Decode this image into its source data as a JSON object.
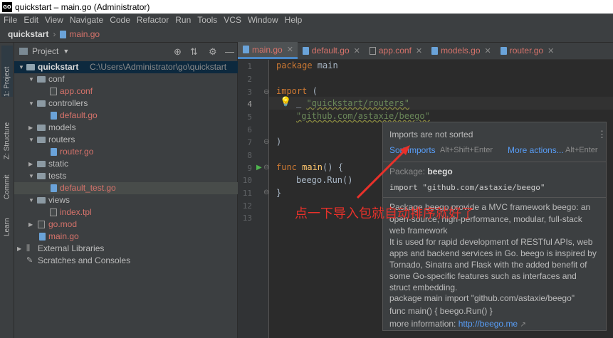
{
  "window": {
    "title": "quickstart – main.go (Administrator)",
    "logo_text": "GO"
  },
  "menu": [
    "File",
    "Edit",
    "View",
    "Navigate",
    "Code",
    "Refactor",
    "Run",
    "Tools",
    "VCS",
    "Window",
    "Help"
  ],
  "navbar": {
    "project": "quickstart",
    "file": "main.go"
  },
  "toolstrip": {
    "project": "1: Project",
    "structure": "Z: Structure",
    "commit": "Commit",
    "learn": "Learn"
  },
  "project_panel": {
    "title": "Project",
    "tree": {
      "root": {
        "label": "quickstart",
        "path": "C:\\Users\\Administrator\\go\\quickstart"
      },
      "conf": "conf",
      "app_conf": "app.conf",
      "controllers": "controllers",
      "default_go": "default.go",
      "models": "models",
      "routers": "routers",
      "router_go": "router.go",
      "static": "static",
      "tests": "tests",
      "default_test_go": "default_test.go",
      "views": "views",
      "index_tpl": "index.tpl",
      "go_mod": "go.mod",
      "main_go": "main.go",
      "external_libraries": "External Libraries",
      "scratches": "Scratches and Consoles"
    }
  },
  "tabs": [
    "main.go",
    "default.go",
    "app.conf",
    "models.go",
    "router.go"
  ],
  "line_numbers": [
    "1",
    "2",
    "3",
    "4",
    "5",
    "6",
    "7",
    "8",
    "9",
    "10",
    "11",
    "12",
    "13"
  ],
  "code": {
    "l1_kw": "package",
    "l1_rest": " main",
    "l3_kw": "import",
    "l3_rest": " (",
    "l4_prefix": "_ ",
    "l4_str": "\"quickstart/routers\"",
    "l5_str": "\"github.com/astaxie/beego\"",
    "l7": ")",
    "l9_kw": "func",
    "l9_fn": " main",
    "l9_rest": "() {",
    "l10": "beego.Run()",
    "l11": "}"
  },
  "popup": {
    "title": "Imports are not sorted",
    "sort_imports": "Sort imports",
    "sort_shortcut": "Alt+Shift+Enter",
    "more_actions": "More actions...",
    "more_shortcut": "Alt+Enter",
    "package_label": "Package:",
    "package_name": "beego",
    "import_line": "import \"github.com/astaxie/beego\"",
    "desc1": "Package beego provide a MVC framework beego: an",
    "desc2": "open-source, high-performance, modular, full-stack",
    "desc3": "web framework",
    "desc4": "It is used for rapid development of RESTful APIs, web",
    "desc5": "apps and backend services in Go. beego is inspired by",
    "desc6": "Tornado, Sinatra and Flask with the added benefit of",
    "desc7": "some Go-specific features such as interfaces and",
    "desc8": "struct embedding.",
    "example1": "package main import \"github.com/astaxie/beego\"",
    "example2": "func main() { beego.Run() }",
    "more_info_label": "more information:",
    "more_info_link": "http://beego.me"
  },
  "annotation": {
    "text": "点一下导入包就自动排序就好了",
    "color": "#e8312a"
  },
  "colors": {
    "accent": "#4a88c7",
    "modified_file": "#d7736b",
    "link": "#589df6"
  }
}
